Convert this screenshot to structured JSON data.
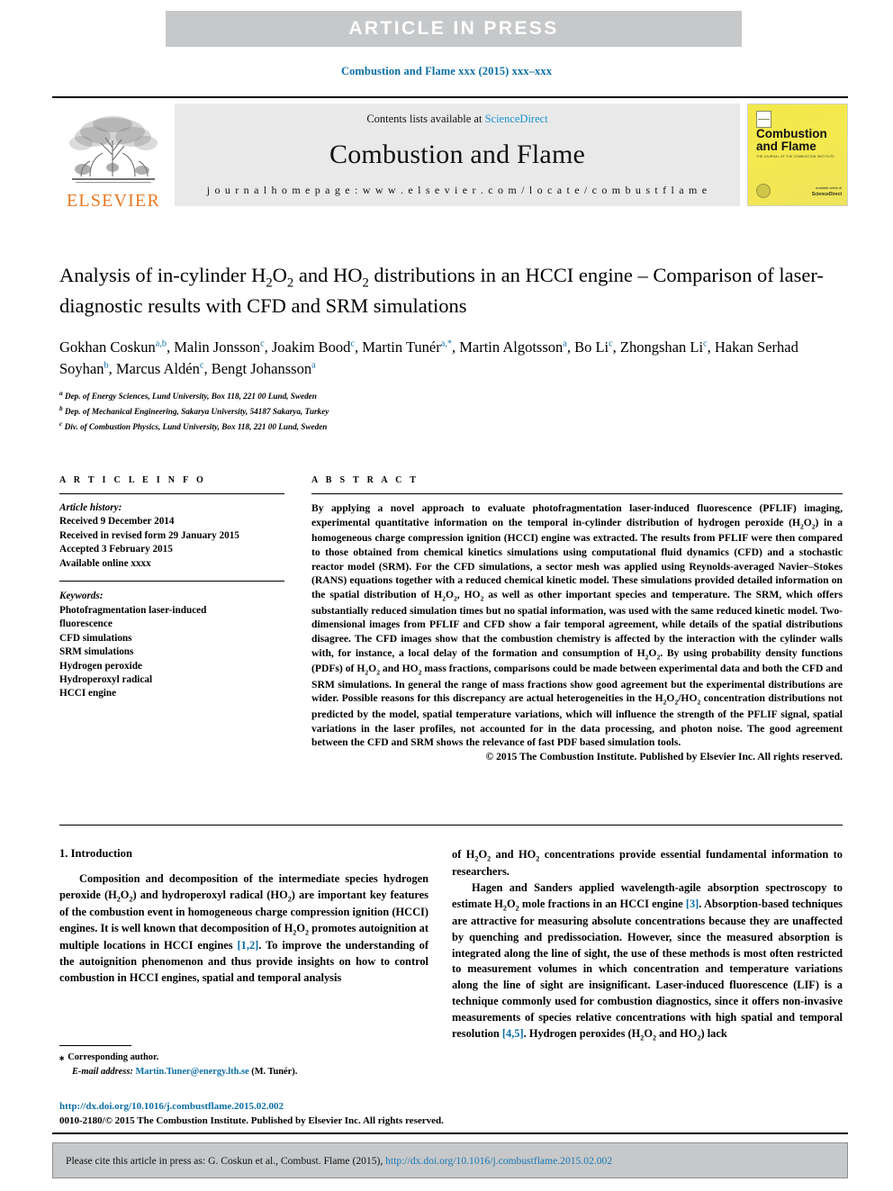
{
  "banner": {
    "text": "ARTICLE IN PRESS"
  },
  "running_head": "Combustion and Flame xxx (2015) xxx–xxx",
  "masthead": {
    "elsevier_wordmark": "ELSEVIER",
    "contents_prefix": "Contents lists available at ",
    "contents_link": "ScienceDirect",
    "journal_title": "Combustion and Flame",
    "homepage": "j o u r n a l   h o m e p a g e :   w w w . e l s e v i e r . c o m / l o c a t e / c o m b u s t f l a m e",
    "cover": {
      "title_line1": "Combustion",
      "title_line2": "and Flame",
      "subtitle": "THE JOURNAL OF THE COMBUSTION INSTITUTE",
      "publisher_line1": "available online at",
      "publisher_line2": "ScienceDirect"
    }
  },
  "article": {
    "title_part1": "Analysis of in-cylinder H",
    "title_sub1": "2",
    "title_part2": "O",
    "title_sub2": "2",
    "title_part3": " and HO",
    "title_sub3": "2",
    "title_part4": " distributions in an HCCI engine – Comparison of laser-diagnostic results with CFD and SRM simulations",
    "authors": [
      {
        "name": "Gokhan Coskun",
        "marks": "a,b",
        "sep": ", "
      },
      {
        "name": "Malin Jonsson",
        "marks": "c",
        "sep": ", "
      },
      {
        "name": "Joakim Bood",
        "marks": "c",
        "sep": ", "
      },
      {
        "name": "Martin Tunér",
        "marks": "a,*",
        "sep": ", "
      },
      {
        "name": "Martin Algotsson",
        "marks": "a",
        "sep": ", "
      },
      {
        "name": "Bo Li",
        "marks": "c",
        "sep": ", "
      },
      {
        "name": "Zhongshan Li",
        "marks": "c",
        "sep": ", "
      },
      {
        "name": "Hakan Serhad Soyhan",
        "marks": "b",
        "sep": ", "
      },
      {
        "name": "Marcus Aldén",
        "marks": "c",
        "sep": ", "
      },
      {
        "name": "Bengt Johansson",
        "marks": "a",
        "sep": ""
      }
    ],
    "affiliations": [
      {
        "mark": "a",
        "text": "Dep. of Energy Sciences, Lund University, Box 118, 221 00 Lund, Sweden"
      },
      {
        "mark": "b",
        "text": "Dep. of Mechanical Engineering, Sakarya University, 54187 Sakarya, Turkey"
      },
      {
        "mark": "c",
        "text": "Div. of Combustion Physics, Lund University, Box 118, 221 00 Lund, Sweden"
      }
    ]
  },
  "article_info": {
    "heading": "A R T I C L E   I N F O",
    "history_label": "Article history:",
    "history": [
      "Received 9 December 2014",
      "Received in revised form 29 January 2015",
      "Accepted 3 February 2015",
      "Available online xxxx"
    ],
    "keywords_label": "Keywords:",
    "keywords": [
      "Photofragmentation laser-induced",
      "fluorescence",
      "CFD simulations",
      "SRM simulations",
      "Hydrogen peroxide",
      "Hydroperoxyl radical",
      "HCCI engine"
    ]
  },
  "abstract": {
    "heading": "A B S T R A C T",
    "text": "By applying a novel approach to evaluate photofragmentation laser-induced fluorescence (PFLIF) imaging, experimental quantitative information on the temporal in-cylinder distribution of hydrogen peroxide (H2O2) in a homogeneous charge compression ignition (HCCI) engine was extracted. The results from PFLIF were then compared to those obtained from chemical kinetics simulations using computational fluid dynamics (CFD) and a stochastic reactor model (SRM). For the CFD simulations, a sector mesh was applied using Reynolds-averaged Navier–Stokes (RANS) equations together with a reduced chemical kinetic model. These simulations provided detailed information on the spatial distribution of H2O2, HO2 as well as other important species and temperature. The SRM, which offers substantially reduced simulation times but no spatial information, was used with the same reduced kinetic model. Two-dimensional images from PFLIF and CFD show a fair temporal agreement, while details of the spatial distributions disagree. The CFD images show that the combustion chemistry is affected by the interaction with the cylinder walls with, for instance, a local delay of the formation and consumption of H2O2. By using probability density functions (PDFs) of H2O2 and HO2 mass fractions, comparisons could be made between experimental data and both the CFD and SRM simulations. In general the range of mass fractions show good agreement but the experimental distributions are wider. Possible reasons for this discrepancy are actual heterogeneities in the H2O2/HO2 concentration distributions not predicted by the model, spatial temperature variations, which will influence the strength of the PFLIF signal, spatial variations in the laser profiles, not accounted for in the data processing, and photon noise. The good agreement between the CFD and SRM shows the relevance of fast PDF based simulation tools.",
    "copyright": "© 2015 The Combustion Institute. Published by Elsevier Inc. All rights reserved."
  },
  "body": {
    "section_heading": "1. Introduction",
    "left_para1_a": "Composition and decomposition of the intermediate species hydrogen peroxide (H2O2) and hydroperoxyl radical (HO2) are important key features of the combustion event in homogeneous charge compression ignition (HCCI) engines. It is well known that decomposition of H2O2 promotes autoignition at multiple locations in HCCI engines ",
    "left_ref1": "[1,2]",
    "left_para1_b": ". To improve the understanding of the autoignition phenomenon and thus provide insights on how to control combustion in HCCI engines, spatial and temporal analysis",
    "right_para1": "of H2O2 and HO2 concentrations provide essential fundamental information to researchers.",
    "right_para2_a": "Hagen and Sanders applied wavelength-agile absorption spectroscopy to estimate H2O2 mole fractions in an HCCI engine ",
    "right_ref1": "[3]",
    "right_para2_b": ". Absorption-based techniques are attractive for measuring absolute concentrations because they are unaffected by quenching and predissociation. However, since the measured absorption is integrated along the line of sight, the use of these methods is most often restricted to measurement volumes in which concentration and temperature variations along the line of sight are insignificant. Laser-induced fluorescence (LIF) is a technique commonly used for combustion diagnostics, since it offers non-invasive measurements of species relative concentrations with high spatial and temporal resolution ",
    "right_ref2": "[4,5]",
    "right_para2_c": ". Hydrogen peroxides (H2O2 and HO2) lack"
  },
  "footnotes": {
    "corresponding_marker": "⁎",
    "corresponding_text": "Corresponding author.",
    "email_label": "E-mail address:",
    "email": "Martin.Tuner@energy.lth.se",
    "email_owner": "(M. Tunér)."
  },
  "doi_block": {
    "doi_url": "http://dx.doi.org/10.1016/j.combustflame.2015.02.002",
    "issn_line": "0010-2180/© 2015 The Combustion Institute. Published by Elsevier Inc. All rights reserved."
  },
  "citation_box": {
    "prefix": "Please cite this article in press as: G. Coskun et al., Combust. Flame (2015), ",
    "doi": "http://dx.doi.org/10.1016/j.combustflame.2015.02.002"
  },
  "colors": {
    "link_blue": "#0b6ea5",
    "banner_grey": "#c6c8ca",
    "elsevier_orange": "#e87722",
    "cover_yellow": "#f2e84a"
  }
}
